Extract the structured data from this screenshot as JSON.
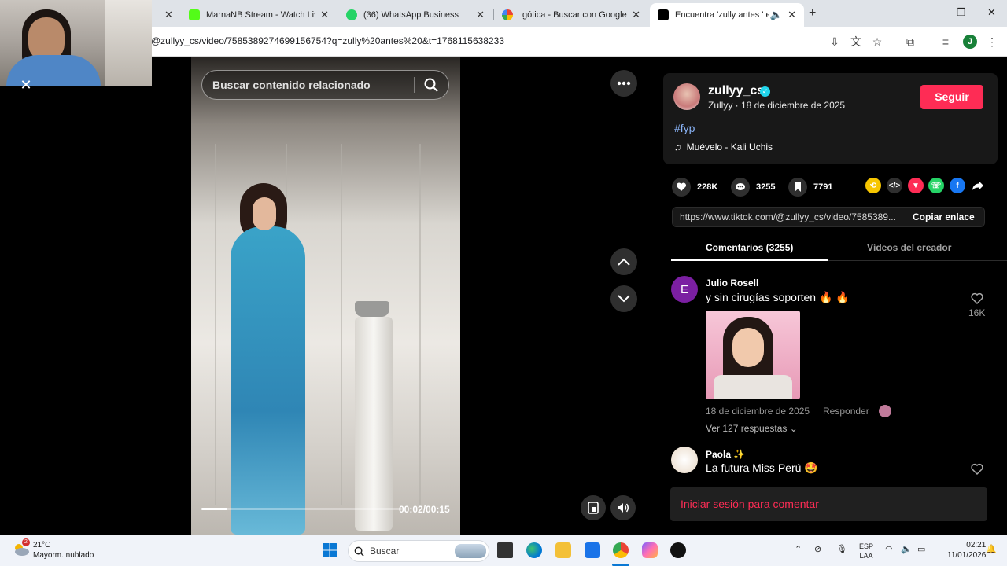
{
  "browser": {
    "tabs": [
      {
        "title": "",
        "icon": "partial-tab-icon"
      },
      {
        "title": "MarnaNB Stream - Watch Live o",
        "icon": "kick-icon"
      },
      {
        "title": "(36) WhatsApp Business",
        "icon": "whatsapp-icon"
      },
      {
        "title": "gótica - Buscar con Google",
        "icon": "google-icon"
      },
      {
        "title": "Encuentra 'zully antes ' en T",
        "icon": "tiktok-icon"
      }
    ],
    "url": "@zullyy_cs/video/7585389274699156754?q=zully%20antes%20&t=1768115638233",
    "profile_initial": "J"
  },
  "video": {
    "search_placeholder": "Buscar contenido relacionado",
    "time": "00:02/00:15",
    "progress_fraction": 0.13
  },
  "creator": {
    "username": "zullyy_cs",
    "subtitle": "Zullyy · 18 de diciembre de 2025",
    "follow_label": "Seguir",
    "hashtag": "#fyp",
    "music": "Muévelo - Kali Uchis"
  },
  "stats": {
    "likes": "228K",
    "comments": "3255",
    "saves": "7791"
  },
  "share": {
    "link": "https://www.tiktok.com/@zullyy_cs/video/7585389...",
    "copy_label": "Copiar enlace",
    "icons": [
      "repost-icon",
      "embed-icon",
      "send-icon",
      "whatsapp-icon",
      "facebook-icon",
      "share-arrow-icon"
    ]
  },
  "tabs": {
    "comments_label": "Comentarios (3255)",
    "creator_label": "Vídeos del creador"
  },
  "comments": [
    {
      "avatar_letter": "E",
      "name": "Julio Rosell",
      "text": "y sin cirugías soporten 🔥 🔥",
      "date": "18 de diciembre de 2025",
      "reply_label": "Responder",
      "replies_label": "Ver 127 respuestas",
      "likes": "16K"
    },
    {
      "avatar_letter": "",
      "name": "Paola ✨",
      "text": "La futura Miss Perú 🤩"
    }
  ],
  "login_label": "Iniciar sesión para comentar",
  "taskbar": {
    "temperature": "21°C",
    "weather": "Mayorm. nublado",
    "search_label": "Buscar",
    "lang1": "ESP",
    "lang2": "LAA",
    "time": "02:21",
    "date": "11/01/2026"
  }
}
